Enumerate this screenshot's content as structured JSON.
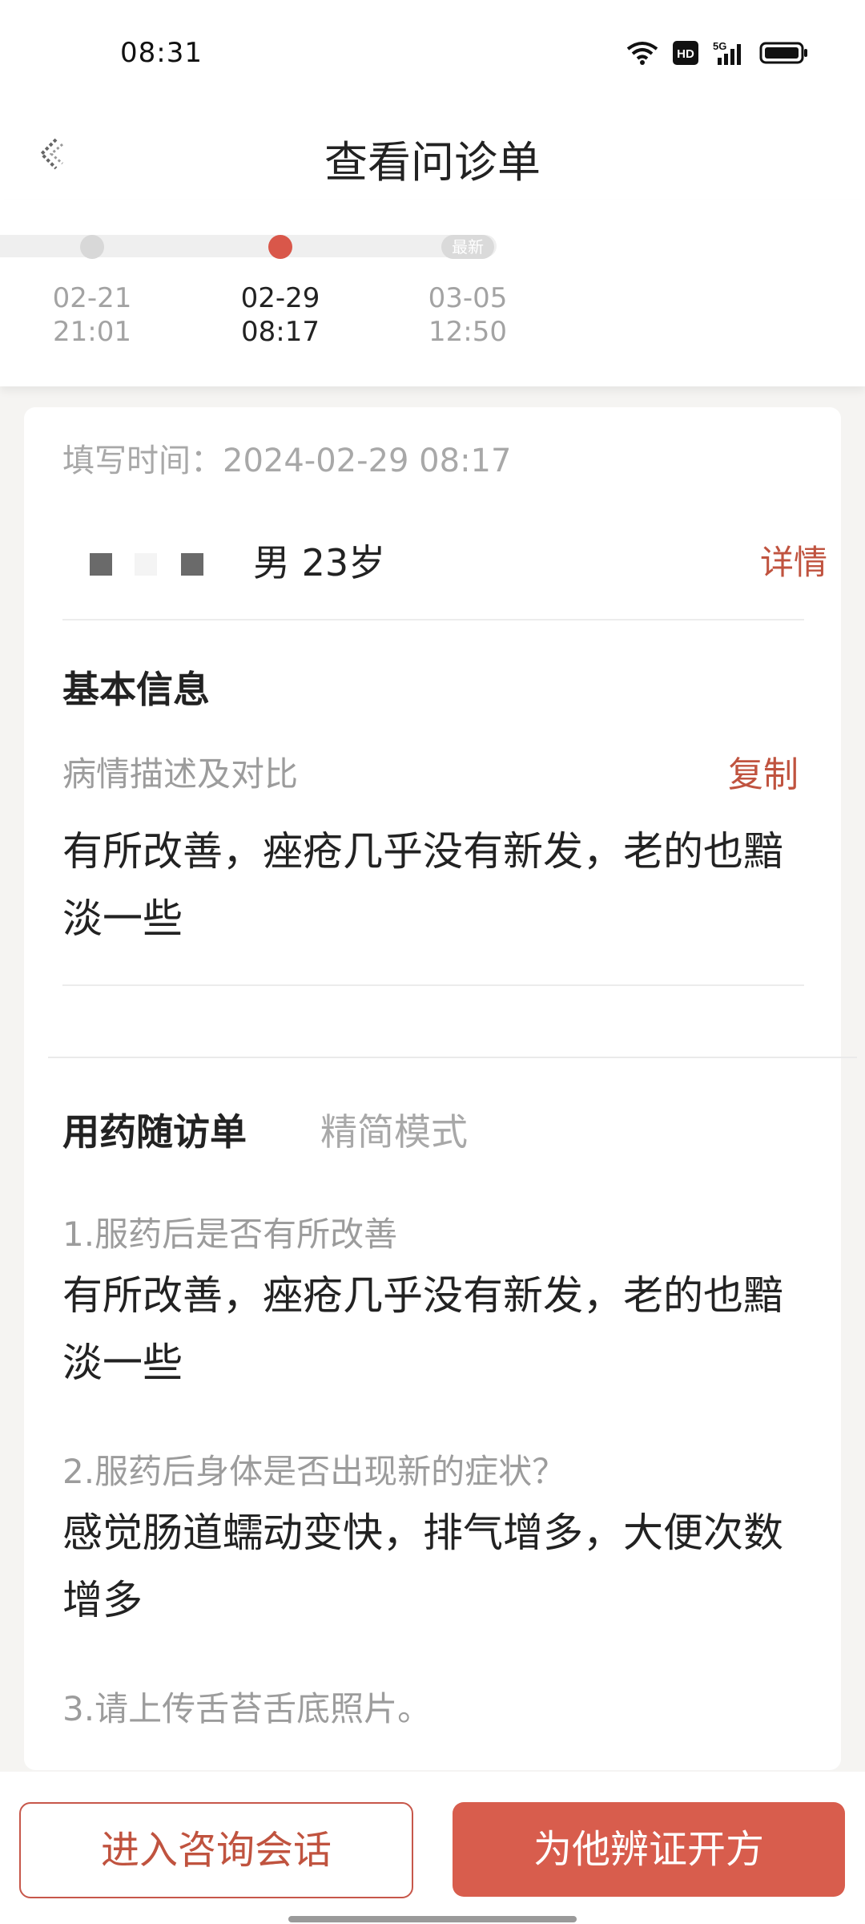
{
  "status_bar": {
    "time": "08:31",
    "icons": [
      "wifi-icon",
      "hd-icon",
      "5g-signal-icon",
      "battery-icon"
    ]
  },
  "header": {
    "title": "查看问诊单",
    "back_icon": "back-icon"
  },
  "timeline": {
    "nodes": [
      {
        "date": "02-21",
        "time": "21:01",
        "active": false,
        "badge": ""
      },
      {
        "date": "02-29",
        "time": "08:17",
        "active": true,
        "badge": ""
      },
      {
        "date": "03-05",
        "time": "12:50",
        "active": false,
        "badge": "最新"
      }
    ]
  },
  "record": {
    "fill_time_label": "填写时间：",
    "fill_time_value": "2024-02-29 08:17",
    "patient": {
      "info": "男 23岁",
      "detail_label": "详情"
    }
  },
  "basic_info": {
    "title": "基本信息",
    "condition_label": "病情描述及对比",
    "copy_label": "复制",
    "condition_text": "有所改善，痤疮几乎没有新发，老的也黯淡一些"
  },
  "followup": {
    "title": "用药随访单",
    "mode_label": "精简模式",
    "questions": [
      {
        "q": "1.服药后是否有所改善",
        "a": "有所改善，痤疮几乎没有新发，老的也黯淡一些"
      },
      {
        "q": "2.服药后身体是否出现新的症状？",
        "a": "感觉肠道蠕动变快，排气增多，大便次数增多"
      },
      {
        "q": "3.请上传舌苔舌底照片。",
        "a": ""
      }
    ]
  },
  "actions": {
    "consult_label": "进入咨询会话",
    "prescribe_label": "为他辨证开方"
  },
  "colors": {
    "accent": "#d85d4d",
    "accent_text": "#c0533f",
    "muted": "#a8a8a8"
  }
}
